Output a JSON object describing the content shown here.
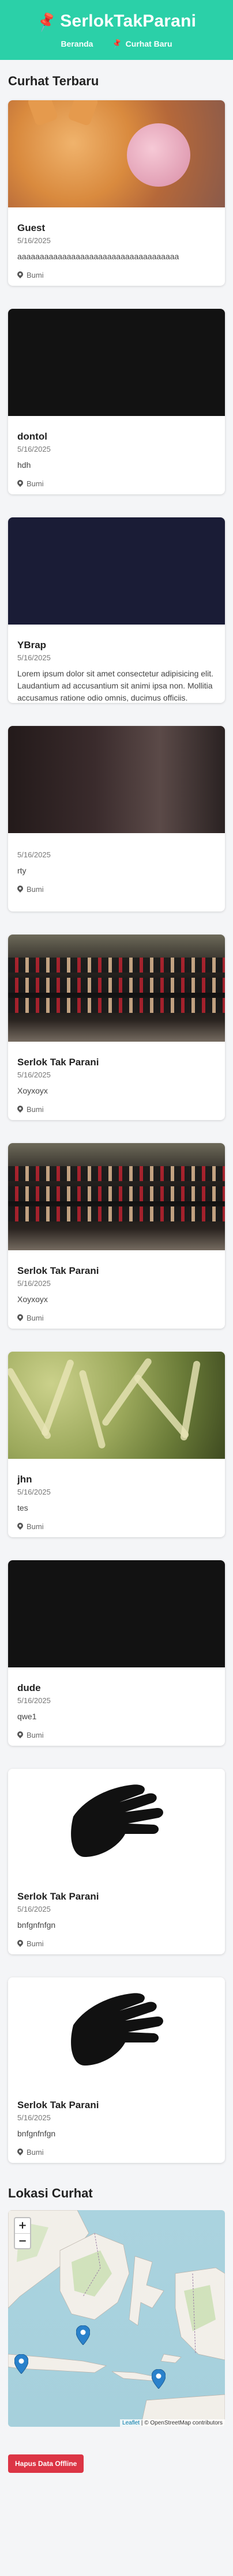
{
  "header": {
    "title": "SerlokTakParani",
    "nav": [
      {
        "label": "Beranda"
      },
      {
        "label": "Curhat Baru"
      }
    ]
  },
  "stories_section": {
    "title": "Curhat Terbaru"
  },
  "stories": [
    {
      "name": "Guest",
      "date": "5/16/2025",
      "description": "aaaaaaaaaaaaaaaaaaaaaaaaaaaaaaaaaaaa",
      "location": "Bumi",
      "photo": "cat"
    },
    {
      "name": "dontol",
      "date": "5/16/2025",
      "description": "hdh",
      "location": "Bumi",
      "photo": "dark"
    },
    {
      "name": "YBrap",
      "date": "5/16/2025",
      "description": "Lorem ipsum dolor sit amet consectetur adipisicing elit. Laudantium ad accusantium sit animi ipsa non. Mollitia accusamus ratione odio omnis, ducimus officiis.",
      "location": "Bumi",
      "photo": "navy"
    },
    {
      "name": "",
      "date": "5/16/2025",
      "description": "rty",
      "location": "Bumi",
      "photo": "room"
    },
    {
      "name": "Serlok Tak Parani",
      "date": "5/16/2025",
      "description": "Xoyxoyx",
      "location": "Bumi",
      "photo": "crowd"
    },
    {
      "name": "Serlok Tak Parani",
      "date": "5/16/2025",
      "description": "Xoyxoyx",
      "location": "Bumi",
      "photo": "crowd"
    },
    {
      "name": "jhn",
      "date": "5/16/2025",
      "description": "tes",
      "location": "Bumi",
      "photo": "corn"
    },
    {
      "name": "dude",
      "date": "5/16/2025",
      "description": "qwe1",
      "location": "Bumi",
      "photo": "dark"
    },
    {
      "name": "Serlok Tak Parani",
      "date": "5/16/2025",
      "description": "bnfgnfnfgn",
      "location": "Bumi",
      "photo": "hands"
    },
    {
      "name": "Serlok Tak Parani",
      "date": "5/16/2025",
      "description": "bnfgnfnfgn",
      "location": "Bumi",
      "photo": "hands"
    }
  ],
  "map_section": {
    "title": "Lokasi Curhat",
    "zoom_in": "+",
    "zoom_out": "−",
    "attribution_leaflet": "Leaflet",
    "attribution_rest": " | © OpenStreetMap contributors"
  },
  "clear_button": {
    "label": "Hapus Data Offline"
  },
  "colors": {
    "header_bg": "#2bd0a8",
    "danger": "#dc3545",
    "marker": "#2a81cb"
  },
  "icons": {
    "brand": "pushpin-icon",
    "location": "map-pin-icon"
  }
}
